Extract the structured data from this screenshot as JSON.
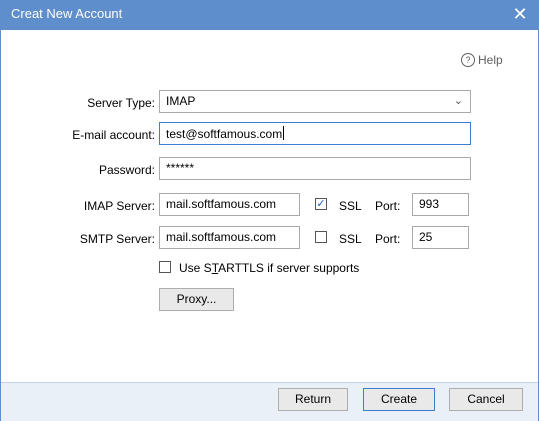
{
  "window": {
    "title": "Creat New Account",
    "close_glyph": "✕"
  },
  "help": {
    "label": "Help",
    "icon": "question-circle-icon",
    "glyph": "?"
  },
  "server_type": {
    "label": "Server Type:",
    "value": "IMAP",
    "arrow": "⌄"
  },
  "email": {
    "label": "E-mail account:",
    "value": "test@softfamous.com"
  },
  "password": {
    "label": "Password:",
    "value": "******"
  },
  "imap": {
    "label": "IMAP Server:",
    "value": "mail.softfamous.com",
    "ssl_label": "SSL",
    "ssl_checked": true,
    "check_glyph": "✓",
    "port_label": "Port:",
    "port": "993"
  },
  "smtp": {
    "label": "SMTP Server:",
    "value": "mail.softfamous.com",
    "ssl_label": "SSL",
    "ssl_checked": false,
    "port_label": "Port:",
    "port": "25"
  },
  "starttls": {
    "label_pre": "Use S",
    "label_accel": "T",
    "label_post": "ARTTLS if server supports",
    "checked": false
  },
  "buttons": {
    "proxy": "Proxy...",
    "return": "Return",
    "create": "Create",
    "cancel": "Cancel"
  }
}
